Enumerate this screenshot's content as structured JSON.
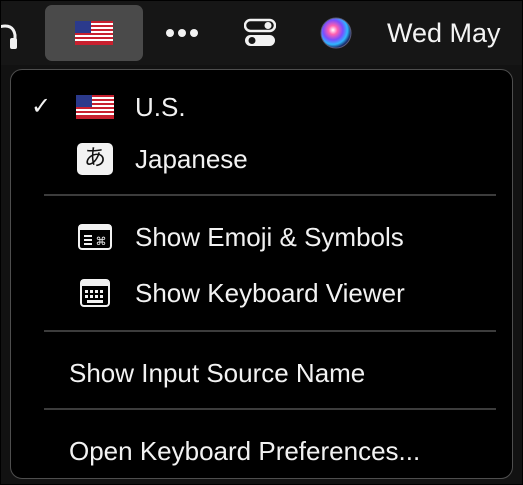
{
  "menubar": {
    "clock": "Wed May",
    "icons": [
      "headphones-icon",
      "us-flag-icon",
      "more-icon",
      "control-center-icon",
      "siri-icon"
    ]
  },
  "menu": {
    "input_sources": [
      {
        "label": "U.S.",
        "icon": "us-flag-icon",
        "checked": true
      },
      {
        "label": "Japanese",
        "icon": "hiragana-a-icon",
        "icon_glyph": "あ",
        "checked": false
      }
    ],
    "tools": [
      {
        "label": "Show Emoji & Symbols",
        "icon": "emoji-symbols-icon"
      },
      {
        "label": "Show Keyboard Viewer",
        "icon": "keyboard-viewer-icon"
      }
    ],
    "show_input_source_name": "Show Input Source Name",
    "open_keyboard_preferences": "Open Keyboard Preferences...",
    "check_mark": "✓"
  },
  "colors": {
    "menu_background": "#000000",
    "menubar_background": "#161616",
    "highlight": "#4a4a4a",
    "text": "#f2f2f2"
  }
}
